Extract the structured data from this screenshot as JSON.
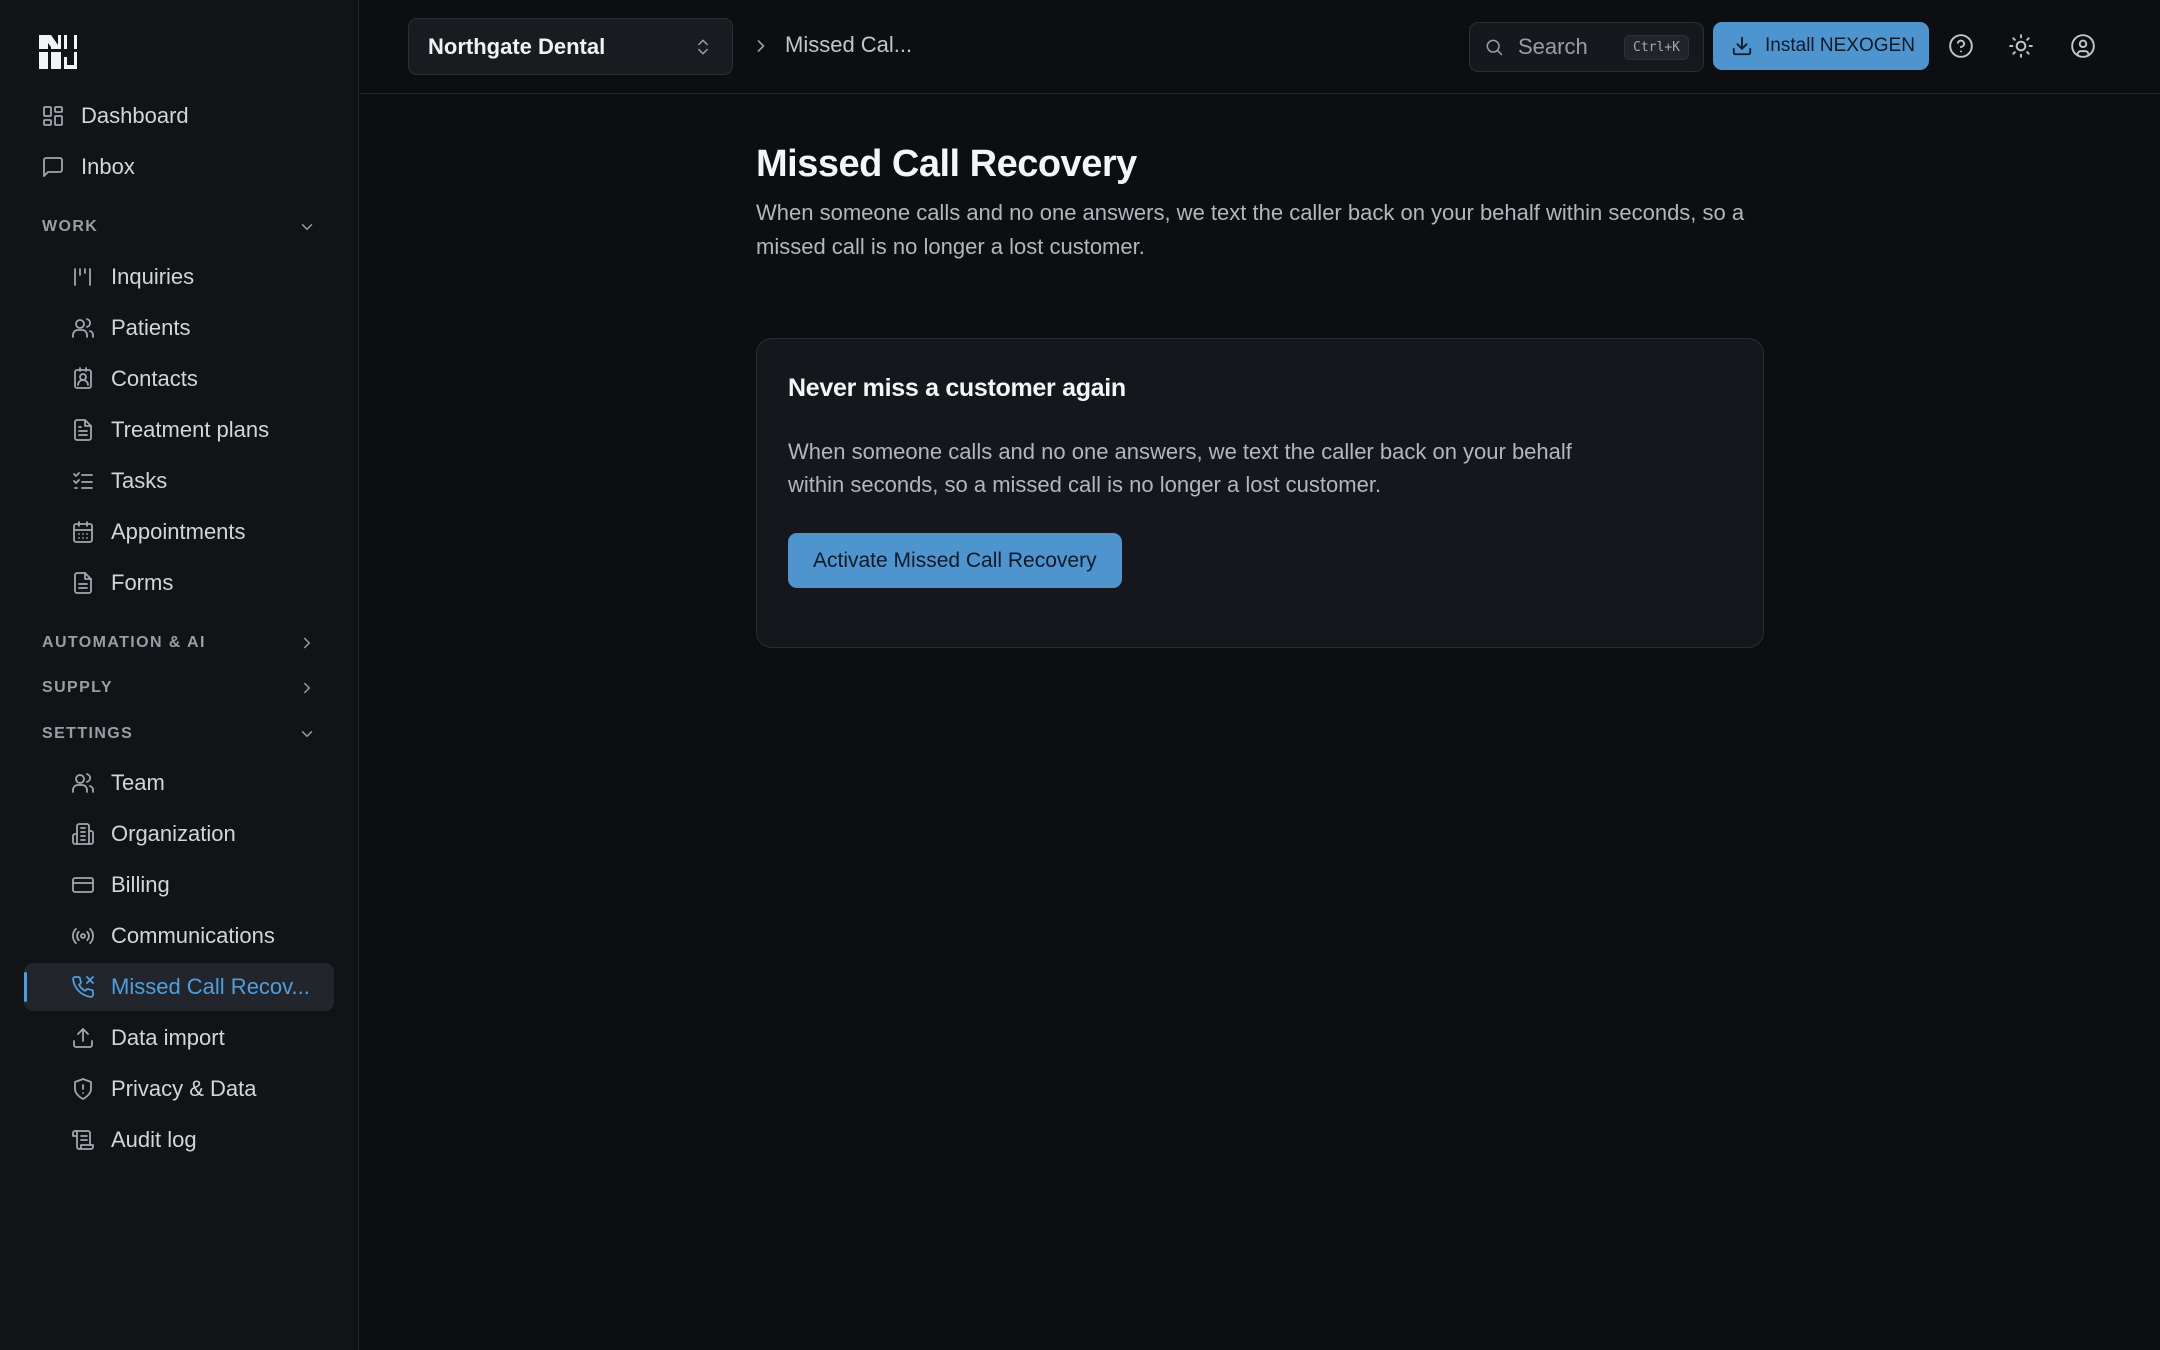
{
  "sidebar": {
    "top_items": [
      {
        "label": "Dashboard",
        "icon": "dashboard-icon"
      },
      {
        "label": "Inbox",
        "icon": "message-square-icon"
      }
    ],
    "sections": [
      {
        "title": "WORK",
        "expanded": true
      },
      {
        "title": "AUTOMATION & AI",
        "expanded": false
      },
      {
        "title": "SUPPLY",
        "expanded": false
      },
      {
        "title": "SETTINGS",
        "expanded": true
      }
    ],
    "work_items": [
      {
        "label": "Inquiries",
        "icon": "inquiries-icon"
      },
      {
        "label": "Patients",
        "icon": "users-icon"
      },
      {
        "label": "Contacts",
        "icon": "contact-card-icon"
      },
      {
        "label": "Treatment plans",
        "icon": "file-text-icon"
      },
      {
        "label": "Tasks",
        "icon": "checklist-icon"
      },
      {
        "label": "Appointments",
        "icon": "calendar-icon"
      },
      {
        "label": "Forms",
        "icon": "file-icon"
      }
    ],
    "settings_items": [
      {
        "label": "Team",
        "icon": "users-icon"
      },
      {
        "label": "Organization",
        "icon": "building-icon"
      },
      {
        "label": "Billing",
        "icon": "credit-card-icon"
      },
      {
        "label": "Communications",
        "icon": "radio-icon"
      },
      {
        "label": "Missed Call Recov...",
        "icon": "phone-missed-icon",
        "active": true
      },
      {
        "label": "Data import",
        "icon": "upload-icon"
      },
      {
        "label": "Privacy & Data",
        "icon": "shield-icon"
      },
      {
        "label": "Audit log",
        "icon": "scroll-icon"
      }
    ]
  },
  "header": {
    "organization": "Northgate Dental",
    "breadcrumb": "Missed Cal...",
    "search_placeholder": "Search",
    "search_shortcut": "Ctrl+K",
    "install_label": "Install NEXOGEN"
  },
  "main": {
    "title": "Missed Call Recovery",
    "description": "When someone calls and no one answers, we text the caller back on your behalf within seconds, so a missed call is no longer a lost customer.",
    "card": {
      "title": "Never miss a customer again",
      "description": "When someone calls and no one answers, we text the caller back on your behalf within seconds, so a missed call is no longer a lost customer.",
      "button_label": "Activate Missed Call Recovery"
    }
  },
  "colors": {
    "accent": "#4e95d0",
    "active_nav_text": "#4e9fe0",
    "background": "#0d0e12",
    "sidebar": "#121317"
  }
}
